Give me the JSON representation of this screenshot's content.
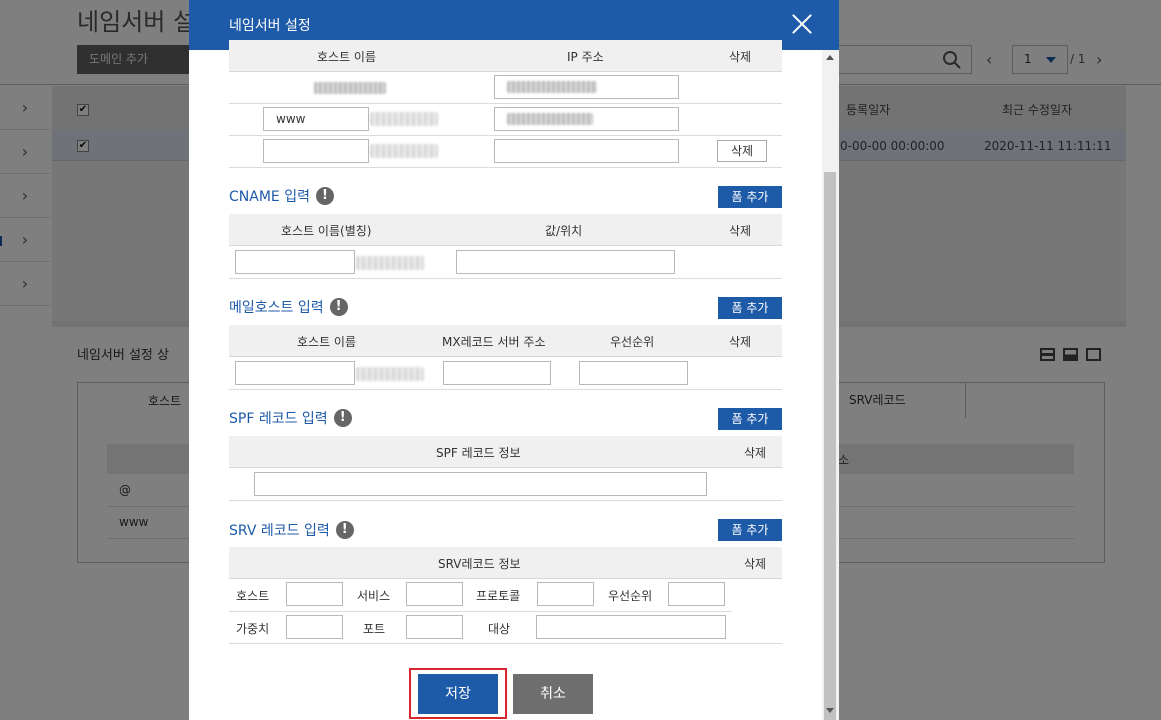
{
  "background": {
    "page_title": "네임서버 설",
    "add_domain_button": "도메인 추가",
    "table_headers": {
      "registered": "등록일자",
      "modified": "최근 수정일자"
    },
    "row": {
      "registered": "0-00-00 00:00:00",
      "modified": "2020-11-11 11:11:11"
    },
    "pager": {
      "page": "1",
      "total": "/ 1"
    },
    "detail_title": "네임서버 설정 상",
    "tabs": {
      "host": "호스트",
      "srv": "SRV레코드"
    },
    "sub_head_text": "소",
    "sub_rows": [
      "@",
      "www"
    ],
    "checkbox_mark": "✔",
    "nav_arrow": "›"
  },
  "modal": {
    "title": "네임서버 설정",
    "a_record": {
      "headers": {
        "host": "호스트 이름",
        "ip": "IP 주소",
        "delete": "삭제"
      },
      "rows": [
        {
          "host": "",
          "ip": ""
        },
        {
          "host": "www",
          "ip": ""
        },
        {
          "host": "",
          "ip": ""
        }
      ],
      "delete_label": "삭제"
    },
    "cname": {
      "title": "CNAME 입력",
      "add_label": "폼 추가",
      "headers": {
        "host": "호스트 이름(별칭)",
        "value": "값/위치",
        "delete": "삭제"
      }
    },
    "mail": {
      "title": "메일호스트 입력",
      "add_label": "폼 추가",
      "headers": {
        "host": "호스트 이름",
        "mx": "MX레코드 서버 주소",
        "priority": "우선순위",
        "delete": "삭제"
      }
    },
    "spf": {
      "title": "SPF 레코드 입력",
      "add_label": "폼 추가",
      "headers": {
        "info": "SPF 레코드 정보",
        "delete": "삭제"
      }
    },
    "srv": {
      "title": "SRV 레코드 입력",
      "add_label": "폼 추가",
      "headers": {
        "info": "SRV레코드 정보",
        "delete": "삭제"
      },
      "labels": {
        "host": "호스트",
        "service": "서비스",
        "protocol": "프로토콜",
        "priority": "우선순위",
        "weight": "가중치",
        "port": "포트",
        "target": "대상"
      }
    },
    "info_glyph": "!",
    "save_label": "저장",
    "cancel_label": "취소"
  }
}
